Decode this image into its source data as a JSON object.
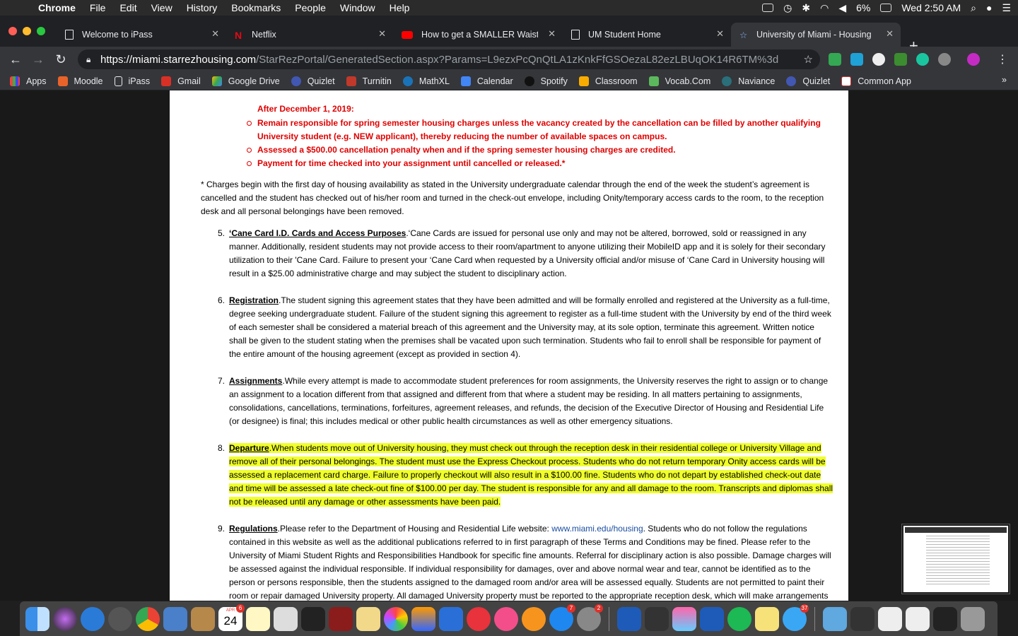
{
  "menubar": {
    "app": "Chrome",
    "items": [
      "File",
      "Edit",
      "View",
      "History",
      "Bookmarks",
      "People",
      "Window",
      "Help"
    ],
    "battery": "6%",
    "clock": "Wed 2:50 AM"
  },
  "tabs": [
    {
      "label": "Welcome to iPass"
    },
    {
      "label": "Netflix"
    },
    {
      "label": "How to get a SMALLER Waist w"
    },
    {
      "label": "UM Student Home"
    },
    {
      "label": "University of Miami - Housing A"
    }
  ],
  "address": {
    "host": "https://miami.starrezhousing.com",
    "path": "/StarRezPortal/GeneratedSection.aspx?Params=L9ezxPcQnQtLA1zKnkFfGSOezaL82ezLBUqOK14R6TM%3d"
  },
  "bookmarks": [
    "Apps",
    "Moodle",
    "iPass",
    "Gmail",
    "Google Drive",
    "Quizlet",
    "Turnitin",
    "MathXL",
    "Calendar",
    "Spotify",
    "Classroom",
    "Vocab.Com",
    "Naviance",
    "Quizlet",
    "Common App"
  ],
  "doc": {
    "after_heading": "After December 1, 2019:",
    "after_items": [
      "Remain responsible for spring semester housing charges unless the vacancy created by the cancellation can be filled by another qualifying University student (e.g. NEW applicant), thereby reducing the number of available spaces on campus.",
      "Assessed a $500.00 cancellation penalty when and if the spring semester housing charges are credited.",
      "Payment for time checked into your assignment until cancelled or released.*"
    ],
    "charges_note": "* Charges begin with the first day of housing availability as stated in the University undergraduate calendar through the end of the week the student’s agreement is cancelled and the student has checked out of his/her room and turned in the check-out envelope, including Onity/temporary access cards to the room, to the reception desk and all personal belongings have been removed.",
    "s5": {
      "num": "5.",
      "title": "‘Cane Card I.D. Cards and Access Purposes",
      "body": ".‘Cane Cards are issued for personal use only and may not be altered, borrowed, sold or reassigned in any manner. Additionally, resident students may not provide access to their room/apartment to anyone utilizing their MobileID app and it is solely for their secondary utilization to their 'Cane Card.  Failure to present your ‘Cane Card when requested by a University official and/or misuse of ‘Cane Card in University housing will result in a $25.00 administrative charge and may subject the student to disciplinary action."
    },
    "s6": {
      "num": "6.",
      "title": "Registration",
      "body": ".The student signing this agreement states that they have been admitted and will be formally enrolled and registered at the University as a full-time, degree seeking undergraduate student. Failure of the student signing this agreement to register as a full-time student with the University by end of the third week of each semester shall be considered a material breach of this agreement and the University may, at its sole option, terminate this agreement. Written notice shall be given to the student stating when the premises shall be vacated upon such termination. Students who fail to enroll shall be responsible for payment of the entire amount of the housing agreement (except as provided in section 4)."
    },
    "s7": {
      "num": "7.",
      "title": "Assignments",
      "body": ".While every attempt is made to accommodate student preferences for room assignments, the University reserves the right to assign or to change an assignment to a location different from that assigned and different from that where a student may be residing. In all matters pertaining to assignments, consolidations, cancellations, terminations, forfeitures, agreement releases, and refunds, the decision of the Executive Director of Housing and Residential Life (or designee) is final; this includes medical or other public health circumstances as well as other emergency situations."
    },
    "s8": {
      "num": "8.",
      "title": "Departure",
      "body": ".When students move out of University housing, they must check out through the reception desk in their residential college or University Village and remove all of their personal belongings. The student must use the Express Checkout process. Students who do not return temporary Onity access cards will be assessed a replacement card charge. Failure to properly checkout will also result in a $100.00 fine. Students who do not depart by established check-out date and time will be assessed a late check-out fine of $100.00 per day. The student is responsible for any and all damage to the room. Transcripts and diplomas shall not be released until any damage or other assessments have been paid."
    },
    "s9": {
      "num": "9.",
      "title": "Regulations",
      "body_a": ".Please refer to the Department of Housing and Residential Life website: ",
      "link": "www.miami.edu/housing",
      "body_b": ". Students who do not follow the regulations contained in this website as well as the additional publications referred to in first paragraph of these Terms and Conditions may be fined. Please refer to the University of Miami Student Rights and Responsibilities Handbook for specific fine amounts. Referral for disciplinary action is also possible. Damage charges will be assessed against the individual responsible. If individual responsibility for damages, over and above normal wear and tear, cannot be identified as to the person or persons responsible, then the students assigned to the damaged room and/or area will be assessed equally. Students are not permitted to paint their room or repair damaged University property. All damaged University property must be reported to the appropriate reception desk, which will make arrangements"
    }
  },
  "dock": {
    "calendar_month": "APR",
    "calendar_day": "24",
    "badges": [
      "6",
      "7",
      "2",
      "37"
    ]
  }
}
